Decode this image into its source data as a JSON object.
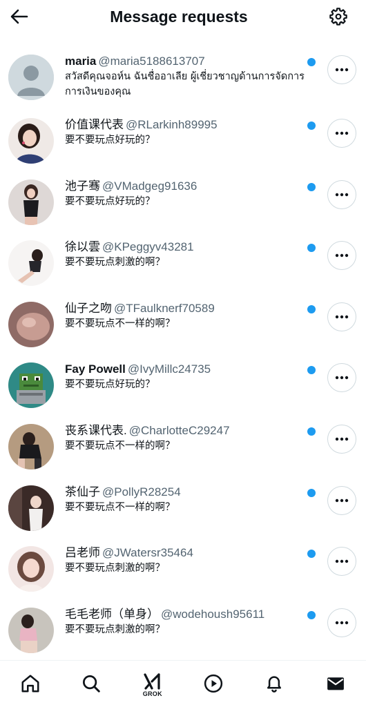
{
  "header": {
    "title": "Message requests",
    "back_icon": "arrow-left-icon",
    "settings_icon": "gear-icon"
  },
  "colors": {
    "unread_dot": "#1d9bf0",
    "handle": "#536471",
    "text": "#0f1419",
    "border": "#cfd9de"
  },
  "requests": [
    {
      "name": "maria",
      "handle": "@maria5188613707",
      "preview": "สวัสดีคุณจอห์น ฉันชื่ออาเลีย ผู้เชี่ยวชาญด้านการจัดการการเงินของคุณ",
      "avatar": "default-avatar",
      "unread": true
    },
    {
      "name": "价值课代表",
      "handle": "@RLarkinh89995",
      "preview": "要不要玩点好玩的？",
      "avatar": "photo-avatar",
      "unread": true
    },
    {
      "name": "池子骞",
      "handle": "@VMadgeg91636",
      "preview": "要不要玩点好玩的？",
      "avatar": "photo-avatar",
      "unread": true
    },
    {
      "name": "徐以雲",
      "handle": "@KPeggyv43281",
      "preview": "要不要玩点刺激的啊？",
      "avatar": "photo-avatar",
      "unread": true
    },
    {
      "name": "仙子之吻",
      "handle": "@TFaulknerf70589",
      "preview": "要不要玩点不一样的啊？",
      "avatar": "photo-avatar",
      "unread": true
    },
    {
      "name": "Fay Powell",
      "handle": "@IvyMillc24735",
      "preview": "要不要玩点好玩的？",
      "avatar": "pixel-frog-avatar",
      "unread": true
    },
    {
      "name": "丧系课代表.",
      "handle": "@CharlotteC29247",
      "preview": "要不要玩点不一样的啊？",
      "avatar": "photo-avatar",
      "unread": true
    },
    {
      "name": "茶仙子",
      "handle": "@PollyR28254",
      "preview": "要不要玩点不一样的啊？",
      "avatar": "photo-avatar",
      "unread": true
    },
    {
      "name": "吕老师",
      "handle": "@JWatersr35464",
      "preview": "要不要玩点刺激的啊？",
      "avatar": "photo-avatar",
      "unread": true
    },
    {
      "name": "毛毛老师（单身）",
      "handle": "@wodehoush95611",
      "preview": "要不要玩点刺激的啊？",
      "avatar": "photo-avatar",
      "unread": true
    }
  ],
  "bottom_nav": {
    "items": [
      {
        "icon": "home-icon"
      },
      {
        "icon": "search-icon"
      },
      {
        "icon": "grok-icon",
        "label": "GROK"
      },
      {
        "icon": "play-icon"
      },
      {
        "icon": "bell-icon"
      },
      {
        "icon": "mail-icon"
      }
    ]
  }
}
